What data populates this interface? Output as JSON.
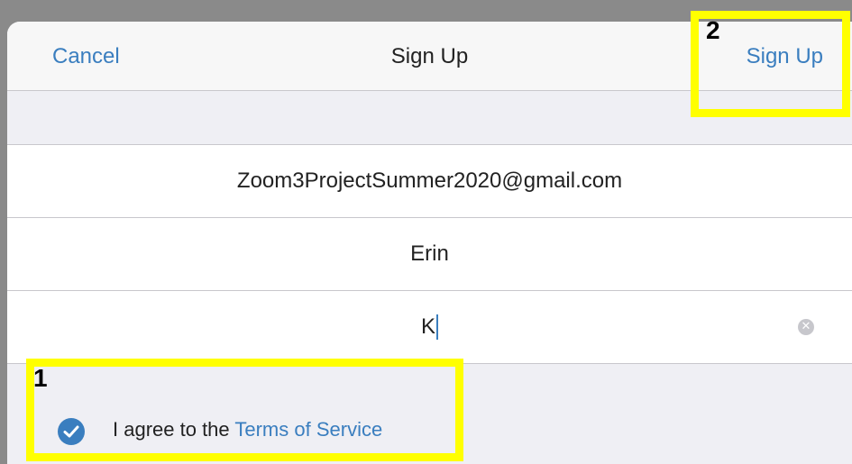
{
  "navbar": {
    "cancel_label": "Cancel",
    "title": "Sign Up",
    "signup_label": "Sign Up"
  },
  "form": {
    "email_value": "Zoom3ProjectSummer2020@gmail.com",
    "first_name_value": "Erin",
    "last_name_value": "K"
  },
  "agreement": {
    "text": "I agree to the ",
    "link": "Terms of Service",
    "checked": true
  },
  "annotations": {
    "label_1": "1",
    "label_2": "2",
    "highlight_color": "#ffff00"
  },
  "colors": {
    "accent": "#3a7ebf"
  }
}
